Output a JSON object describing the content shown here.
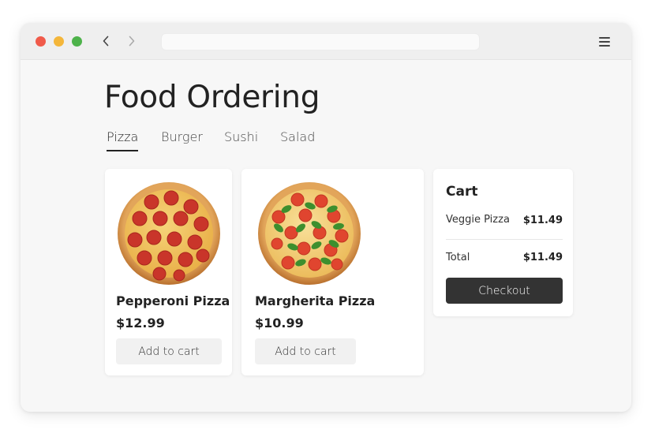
{
  "window": {
    "controls": [
      "close",
      "minimize",
      "maximize"
    ],
    "nav": {
      "back_icon": "chevron-left-icon",
      "forward_icon": "chevron-right-icon"
    },
    "address_bar": {
      "value": ""
    },
    "menu_icon": "hamburger-menu-icon"
  },
  "page": {
    "title": "Food Ordering"
  },
  "tabs": [
    {
      "label": "Pizza",
      "active": true
    },
    {
      "label": "Burger",
      "active": false
    },
    {
      "label": "Sushi",
      "active": false
    },
    {
      "label": "Salad",
      "active": false
    }
  ],
  "products": [
    {
      "name": "Pepperoni Pizza",
      "price": "$12.99",
      "button": "Add to cart",
      "image": "pepperoni-pizza"
    },
    {
      "name": "Margherita Pizza",
      "price": "$10.99",
      "button": "Add to cart",
      "image": "margherita-pizza"
    }
  ],
  "cart": {
    "title": "Cart",
    "items": [
      {
        "name": "Veggie Pizza",
        "price": "$11.49"
      }
    ],
    "total_label": "Total",
    "total_value": "$11.49",
    "checkout_label": "Checkout"
  },
  "colors": {
    "close": "#f05a4a",
    "minimize": "#f4b63a",
    "maximize": "#4db24a",
    "checkout_bg": "#333333",
    "text": "#222222"
  }
}
